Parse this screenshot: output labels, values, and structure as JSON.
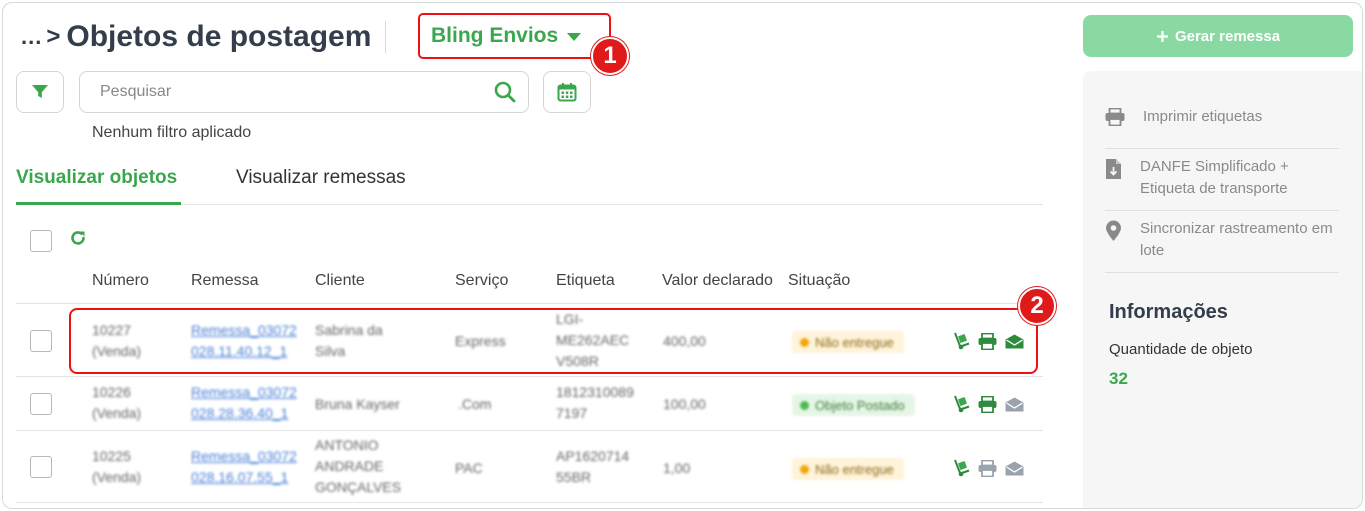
{
  "header": {
    "breadcrumb_dots": "...",
    "breadcrumb_sep": ">",
    "title": "Objetos de postagem",
    "carrier_label": "Bling Envios"
  },
  "markers": {
    "one": "1",
    "two": "2"
  },
  "toolbar": {
    "search_placeholder": "Pesquisar",
    "filter_note": "Nenhum filtro aplicado"
  },
  "tabs": [
    {
      "label": "Visualizar objetos",
      "active": true
    },
    {
      "label": "Visualizar remessas",
      "active": false
    }
  ],
  "table": {
    "columns": [
      "Número",
      "Remessa",
      "Cliente",
      "Serviço",
      "Etiqueta",
      "Valor declarado",
      "Situação"
    ],
    "rows": [
      {
        "numero": [
          "10227",
          "(Venda)"
        ],
        "remessa": [
          "Remessa_03072",
          "028.11.40.12_1"
        ],
        "cliente": [
          "Sabrina da",
          "Silva"
        ],
        "servico": "Express",
        "etiqueta": [
          "LGI-",
          "ME262AEC",
          "V508R"
        ],
        "valor": "400,00",
        "situacao": "Não entregue",
        "status": "warn",
        "email_active": true
      },
      {
        "numero": [
          "10226",
          "(Venda)"
        ],
        "remessa": [
          "Remessa_03072",
          "028.28.36.40_1"
        ],
        "cliente": [
          "Bruna Kayser"
        ],
        "servico": ".Com",
        "etiqueta": [
          "1812310089",
          "7197"
        ],
        "valor": "100,00",
        "situacao": "Objeto Postado",
        "status": "ok",
        "email_active": false
      },
      {
        "numero": [
          "10225",
          "(Venda)"
        ],
        "remessa": [
          "Remessa_03072",
          "028.16.07.55_1"
        ],
        "cliente": [
          "ANTONIO",
          "ANDRADE",
          "GONÇALVES"
        ],
        "servico": "PAC",
        "etiqueta": [
          "AP1620714",
          "55BR"
        ],
        "valor": "1,00",
        "situacao": "Não entregue",
        "status": "warn",
        "email_active": false
      }
    ]
  },
  "side": {
    "generate_button": "Gerar remessa",
    "actions": [
      {
        "label": "Imprimir etiquetas",
        "icon": "printer-icon"
      },
      {
        "label": "DANFE Simplificado + Etiqueta de transporte",
        "icon": "file-download-icon"
      },
      {
        "label": "Sincronizar rastreamento em lote",
        "icon": "map-pin-icon"
      }
    ],
    "info_title": "Informações",
    "info_label": "Quantidade de objeto",
    "info_value": "32"
  },
  "colors": {
    "accent": "#3aa74f",
    "highlight": "#e11111",
    "primary_button": "#8ad9a3"
  }
}
